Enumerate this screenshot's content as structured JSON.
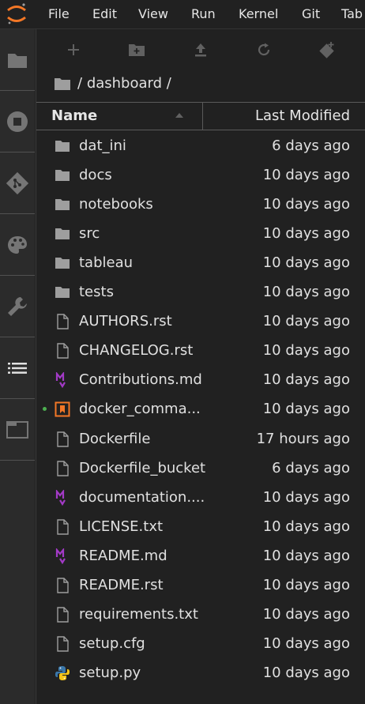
{
  "menubar": {
    "items": [
      "File",
      "Edit",
      "View",
      "Run",
      "Kernel",
      "Git",
      "Tab"
    ]
  },
  "breadcrumb": {
    "separator": "/",
    "folder": "dashboard",
    "trailing": "/"
  },
  "table_header": {
    "name": "Name",
    "modified": "Last Modified"
  },
  "files": [
    {
      "name": "dat_ini",
      "modified": "6 days ago",
      "icon": "folder-icon"
    },
    {
      "name": "docs",
      "modified": "10 days ago",
      "icon": "folder-icon"
    },
    {
      "name": "notebooks",
      "modified": "10 days ago",
      "icon": "folder-icon"
    },
    {
      "name": "src",
      "modified": "10 days ago",
      "icon": "folder-icon"
    },
    {
      "name": "tableau",
      "modified": "10 days ago",
      "icon": "folder-icon"
    },
    {
      "name": "tests",
      "modified": "10 days ago",
      "icon": "folder-icon"
    },
    {
      "name": "AUTHORS.rst",
      "modified": "10 days ago",
      "icon": "file-icon"
    },
    {
      "name": "CHANGELOG.rst",
      "modified": "10 days ago",
      "icon": "file-icon"
    },
    {
      "name": "Contributions.md",
      "modified": "10 days ago",
      "icon": "markdown-icon"
    },
    {
      "name": "docker_comma...",
      "modified": "10 days ago",
      "icon": "notebook-icon"
    },
    {
      "name": "Dockerfile",
      "modified": "17 hours ago",
      "icon": "file-icon"
    },
    {
      "name": "Dockerfile_bucket",
      "modified": "6 days ago",
      "icon": "file-icon"
    },
    {
      "name": "documentation....",
      "modified": "10 days ago",
      "icon": "markdown-icon"
    },
    {
      "name": "LICENSE.txt",
      "modified": "10 days ago",
      "icon": "file-icon"
    },
    {
      "name": "README.md",
      "modified": "10 days ago",
      "icon": "markdown-icon"
    },
    {
      "name": "README.rst",
      "modified": "10 days ago",
      "icon": "file-icon"
    },
    {
      "name": "requirements.txt",
      "modified": "10 days ago",
      "icon": "file-icon"
    },
    {
      "name": "setup.cfg",
      "modified": "10 days ago",
      "icon": "file-icon"
    },
    {
      "name": "setup.py",
      "modified": "10 days ago",
      "icon": "python-icon"
    }
  ],
  "colors": {
    "accent": "#f37726",
    "markdown": "#a33ac7",
    "running": "#4caf50",
    "python_blue": "#3b77a8",
    "python_yellow": "#f5c518"
  }
}
